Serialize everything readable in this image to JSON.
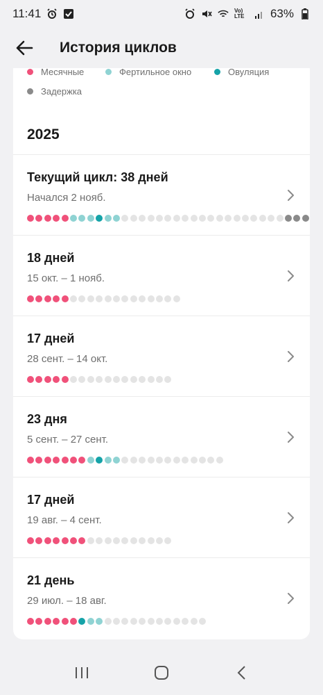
{
  "status": {
    "time": "11:41",
    "battery": "63%",
    "lte_label": "Vo) LTE"
  },
  "header": {
    "title": "История циклов",
    "back_icon": "arrow-back-icon"
  },
  "legend": [
    {
      "label": "Месячные",
      "color": "#f0517a"
    },
    {
      "label": "Фертильное окно",
      "color": "#8fd3d3"
    },
    {
      "label": "Овуляция",
      "color": "#15a3a8"
    },
    {
      "label": "Задержка",
      "color": "#8a8a8a"
    }
  ],
  "colors": {
    "period": "#f0517a",
    "fertile": "#8fd3d3",
    "ovulation": "#15a3a8",
    "regular": "#e4e4e4",
    "delay": "#8a8a8a"
  },
  "year": "2025",
  "cycles": [
    {
      "title": "Текущий цикл: 38 дней",
      "subtitle": "Начался 2 нояб.",
      "days": [
        "p",
        "p",
        "p",
        "p",
        "p",
        "f",
        "f",
        "f",
        "o",
        "f",
        "f",
        "n",
        "n",
        "n",
        "n",
        "n",
        "n",
        "n",
        "n",
        "n",
        "n",
        "n",
        "n",
        "n",
        "n",
        "n",
        "n",
        "n",
        "n",
        "n",
        "n",
        "n",
        "n",
        "n",
        "n",
        "n",
        "n",
        "n"
      ],
      "delay_start": 30
    },
    {
      "title": "18 дней",
      "subtitle": "15 окт. – 1 нояб.",
      "days": [
        "p",
        "p",
        "p",
        "p",
        "p",
        "n",
        "n",
        "n",
        "n",
        "n",
        "n",
        "n",
        "n",
        "n",
        "n",
        "n",
        "n",
        "n"
      ]
    },
    {
      "title": "17 дней",
      "subtitle": "28 сент. – 14 окт.",
      "days": [
        "p",
        "p",
        "p",
        "p",
        "p",
        "n",
        "n",
        "n",
        "n",
        "n",
        "n",
        "n",
        "n",
        "n",
        "n",
        "n",
        "n"
      ]
    },
    {
      "title": "23 дня",
      "subtitle": "5 сент. – 27 сент.",
      "days": [
        "p",
        "p",
        "p",
        "p",
        "p",
        "p",
        "p",
        "f",
        "o",
        "f",
        "f",
        "n",
        "n",
        "n",
        "n",
        "n",
        "n",
        "n",
        "n",
        "n",
        "n",
        "n",
        "n"
      ]
    },
    {
      "title": "17 дней",
      "subtitle": "19 авг. – 4 сент.",
      "days": [
        "p",
        "p",
        "p",
        "p",
        "p",
        "p",
        "p",
        "n",
        "n",
        "n",
        "n",
        "n",
        "n",
        "n",
        "n",
        "n",
        "n"
      ]
    },
    {
      "title": "21 день",
      "subtitle": "29 июл. – 18 авг.",
      "days": [
        "p",
        "p",
        "p",
        "p",
        "p",
        "p",
        "o",
        "f",
        "f",
        "n",
        "n",
        "n",
        "n",
        "n",
        "n",
        "n",
        "n",
        "n",
        "n",
        "n",
        "n"
      ]
    }
  ],
  "nav": {
    "recent_icon": "recent-apps-icon",
    "home_icon": "home-icon",
    "back_icon": "nav-back-icon"
  }
}
